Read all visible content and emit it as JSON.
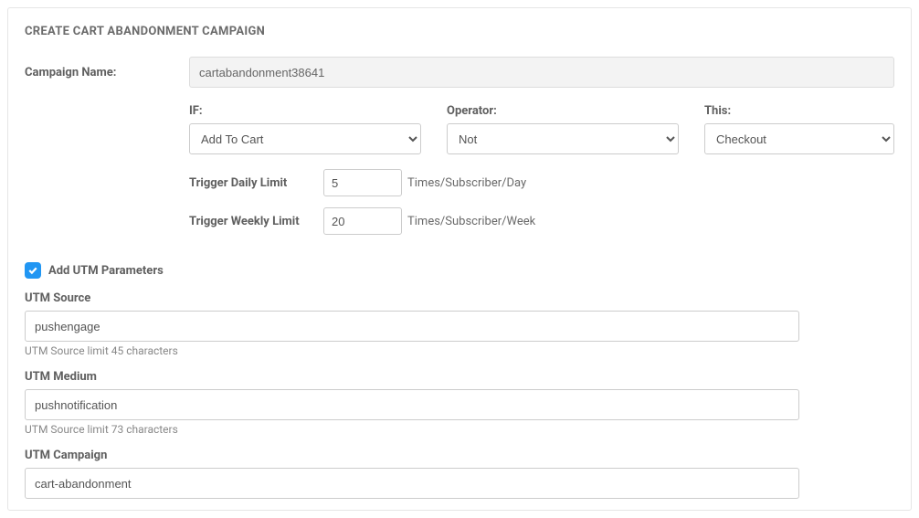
{
  "panel": {
    "title": "CREATE CART ABANDONMENT CAMPAIGN"
  },
  "campaign": {
    "name_label": "Campaign Name:",
    "name_value": "cartabandonment38641"
  },
  "conditions": {
    "if_label": "IF:",
    "if_value": "Add To Cart",
    "operator_label": "Operator:",
    "operator_value": "Not",
    "this_label": "This:",
    "this_value": "Checkout"
  },
  "triggers": {
    "daily_label": "Trigger Daily Limit",
    "daily_value": "5",
    "daily_suffix": "Times/Subscriber/Day",
    "weekly_label": "Trigger Weekly Limit",
    "weekly_value": "20",
    "weekly_suffix": "Times/Subscriber/Week"
  },
  "utm": {
    "checkbox_label": "Add UTM Parameters",
    "source_label": "UTM Source",
    "source_value": "pushengage",
    "source_hint": "UTM Source limit 45 characters",
    "medium_label": "UTM Medium",
    "medium_value": "pushnotification",
    "medium_hint": "UTM Source limit 73 characters",
    "campaign_label": "UTM Campaign",
    "campaign_value": "cart-abandonment"
  }
}
